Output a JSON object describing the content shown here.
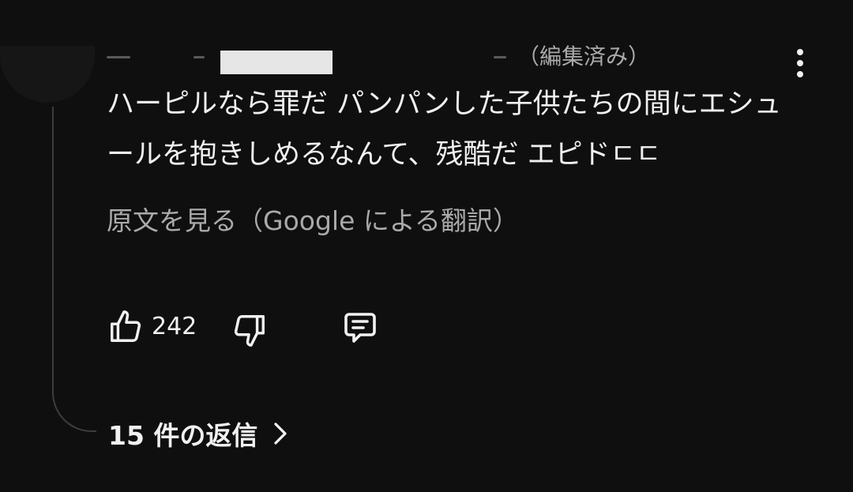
{
  "comment": {
    "edited_label": "（編集済み）",
    "text": "ハーピルなら罪だ パンパンした子供たちの間にエシュールを抱きしめるなんて、残酷だ エピドㄷㄷ",
    "translate_link": "原文を見る（Google による翻訳）",
    "like_count": "242",
    "replies_label": "15 件の返信"
  },
  "icons": {
    "more": "more-vertical-icon",
    "like": "thumb-up-icon",
    "dislike": "thumb-down-icon",
    "reply": "comment-icon",
    "chevron": "chevron-right-icon"
  },
  "colors": {
    "background": "#0f0f0f",
    "primary_text": "#f1f1f1",
    "secondary_text": "#aaaaaa",
    "thread_line": "#3d3d3d"
  }
}
